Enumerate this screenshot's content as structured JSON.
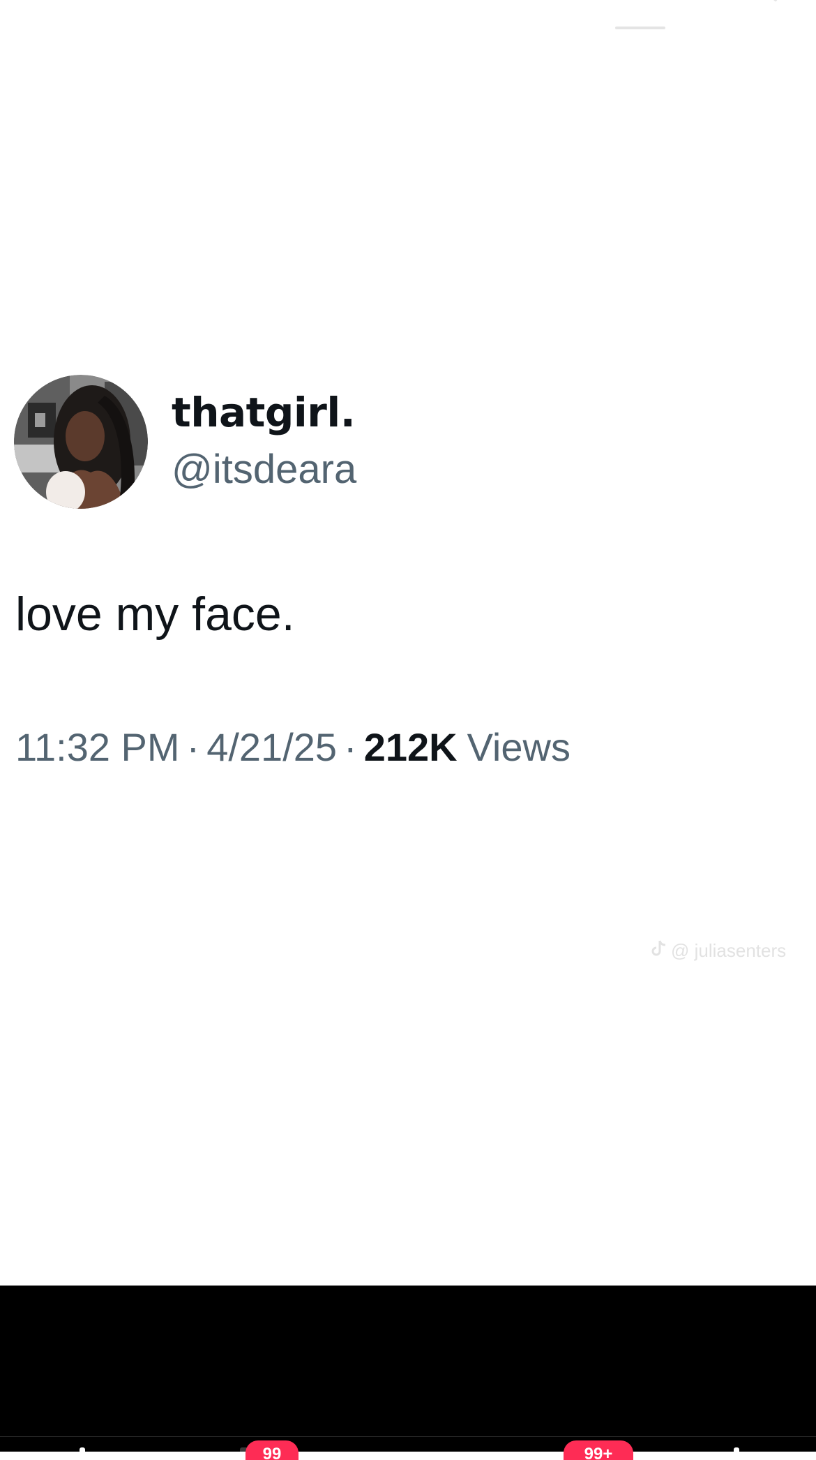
{
  "tweet": {
    "display_name": "thatgirl.",
    "handle": "@itsdeara",
    "text": "love my face.",
    "time": "11:32 PM",
    "separator": "·",
    "date": "4/21/25",
    "views_count": "212K",
    "views_label": "Views"
  },
  "watermark": {
    "text": "@ juliasenters"
  },
  "bottom_nav": {
    "badges": [
      "99",
      "99+"
    ]
  },
  "icons": {
    "search": "search-icon",
    "tiktok": "tiktok-logo-icon"
  },
  "colors": {
    "background": "#ffffff",
    "primary_text": "#0f1419",
    "secondary_text": "#536471",
    "bottom_bar": "#000000",
    "badge": "#fe2c55"
  }
}
